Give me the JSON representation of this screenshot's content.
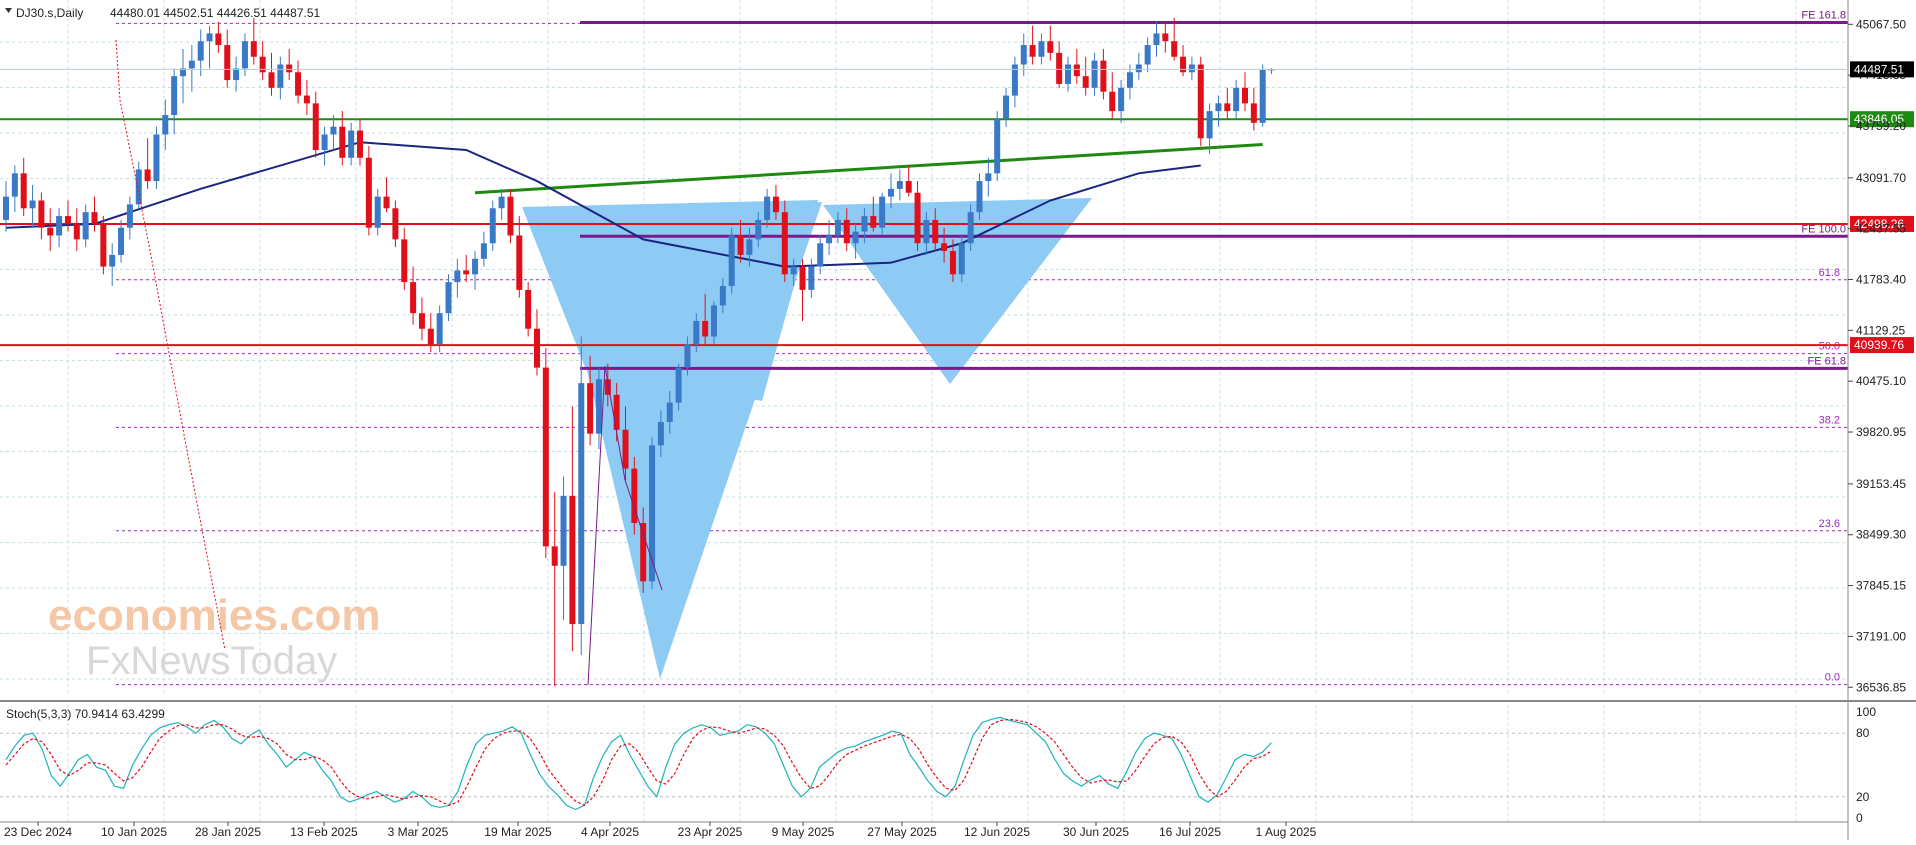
{
  "chart_data": {
    "type": "candlestick",
    "symbol_header": "DJ30.s,Daily",
    "ohlc_header": "44480.01 44502.51 44426.51 44487.51",
    "price_axis_ticks": [
      "45067.50",
      "44413.35",
      "43759.20",
      "43091.70",
      "42437.55",
      "41783.40",
      "41129.25",
      "40475.10",
      "39820.95",
      "39153.45",
      "38499.30",
      "37845.15",
      "37191.00",
      "36536.85"
    ],
    "date_ticks": [
      "23 Dec 2024",
      "10 Jan 2025",
      "28 Jan 2025",
      "13 Feb 2025",
      "3 Mar 2025",
      "19 Mar 2025",
      "4 Apr 2025",
      "23 Apr 2025",
      "9 May 2025",
      "27 May 2025",
      "12 Jun 2025",
      "30 Jun 2025",
      "16 Jul 2025",
      "1 Aug 2025"
    ],
    "ylim": [
      36450,
      45380
    ],
    "candles": [
      [
        42550,
        43050,
        42400,
        42850
      ],
      [
        42850,
        43250,
        42650,
        43150
      ],
      [
        43150,
        43350,
        42600,
        42700
      ],
      [
        42700,
        43000,
        42450,
        42800
      ],
      [
        42800,
        42900,
        42300,
        42450
      ],
      [
        42450,
        42700,
        42150,
        42350
      ],
      [
        42350,
        42700,
        42200,
        42600
      ],
      [
        42600,
        42800,
        42400,
        42500
      ],
      [
        42500,
        42700,
        42150,
        42300
      ],
      [
        42300,
        42750,
        42200,
        42650
      ],
      [
        42650,
        42850,
        42400,
        42500
      ],
      [
        42500,
        42600,
        41850,
        41950
      ],
      [
        41950,
        42250,
        41700,
        42100
      ],
      [
        42100,
        42550,
        42000,
        42450
      ],
      [
        42450,
        42850,
        42300,
        42750
      ],
      [
        42750,
        43300,
        42700,
        43200
      ],
      [
        43200,
        43600,
        42950,
        43050
      ],
      [
        43050,
        43750,
        42950,
        43650
      ],
      [
        43650,
        44100,
        43450,
        43900
      ],
      [
        43900,
        44500,
        43650,
        44400
      ],
      [
        44400,
        44750,
        44050,
        44500
      ],
      [
        44500,
        44800,
        44200,
        44600
      ],
      [
        44600,
        45000,
        44400,
        44850
      ],
      [
        44850,
        45050,
        44500,
        44950
      ],
      [
        44950,
        45100,
        44700,
        44800
      ],
      [
        44800,
        45000,
        44250,
        44350
      ],
      [
        44350,
        44650,
        44200,
        44500
      ],
      [
        44500,
        44950,
        44400,
        44850
      ],
      [
        44850,
        45150,
        44550,
        44650
      ],
      [
        44650,
        44850,
        44350,
        44450
      ],
      [
        44450,
        44700,
        44150,
        44250
      ],
      [
        44250,
        44650,
        44100,
        44550
      ],
      [
        44550,
        44750,
        44350,
        44450
      ],
      [
        44450,
        44600,
        44050,
        44150
      ],
      [
        44150,
        44350,
        43900,
        44050
      ],
      [
        44050,
        44200,
        43350,
        43450
      ],
      [
        43450,
        43750,
        43250,
        43650
      ],
      [
        43650,
        43900,
        43450,
        43750
      ],
      [
        43750,
        43950,
        43250,
        43350
      ],
      [
        43350,
        43800,
        43250,
        43700
      ],
      [
        43700,
        43850,
        43250,
        43350
      ],
      [
        43350,
        43500,
        42350,
        42450
      ],
      [
        42450,
        42950,
        42350,
        42850
      ],
      [
        42850,
        43100,
        42650,
        42700
      ],
      [
        42700,
        42800,
        42200,
        42300
      ],
      [
        42300,
        42450,
        41650,
        41750
      ],
      [
        41750,
        41950,
        41200,
        41350
      ],
      [
        41350,
        41550,
        41000,
        41150
      ],
      [
        41150,
        41350,
        40850,
        40950
      ],
      [
        40950,
        41450,
        40850,
        41350
      ],
      [
        41350,
        41850,
        41250,
        41750
      ],
      [
        41750,
        42050,
        41550,
        41900
      ],
      [
        41900,
        42100,
        41750,
        41850
      ],
      [
        41850,
        42150,
        41650,
        42050
      ],
      [
        42050,
        42400,
        41950,
        42250
      ],
      [
        42250,
        42800,
        42150,
        42700
      ],
      [
        42700,
        42950,
        42550,
        42850
      ],
      [
        42850,
        42950,
        42250,
        42350
      ],
      [
        42350,
        42600,
        41550,
        41650
      ],
      [
        41650,
        41750,
        41050,
        41150
      ],
      [
        41150,
        41400,
        40550,
        40650
      ],
      [
        40650,
        40900,
        38200,
        38350
      ],
      [
        38350,
        39050,
        36550,
        38100
      ],
      [
        38100,
        39250,
        37400,
        39000
      ],
      [
        39000,
        40150,
        37000,
        37350
      ],
      [
        37350,
        41050,
        36950,
        40450
      ],
      [
        40450,
        40800,
        39650,
        39800
      ],
      [
        39800,
        40650,
        39600,
        40500
      ],
      [
        40500,
        40700,
        40150,
        40300
      ],
      [
        40300,
        40450,
        39700,
        39850
      ],
      [
        39850,
        40150,
        39200,
        39350
      ],
      [
        39350,
        39500,
        38500,
        38650
      ],
      [
        38650,
        38850,
        37750,
        37900
      ],
      [
        37900,
        39750,
        37800,
        39650
      ],
      [
        39650,
        40100,
        39500,
        39950
      ],
      [
        39950,
        40350,
        39800,
        40200
      ],
      [
        40200,
        40700,
        40100,
        40650
      ],
      [
        40650,
        41050,
        40550,
        40950
      ],
      [
        40950,
        41350,
        40850,
        41250
      ],
      [
        41250,
        41600,
        40950,
        41050
      ],
      [
        41050,
        41500,
        40950,
        41450
      ],
      [
        41450,
        41800,
        41350,
        41700
      ],
      [
        41700,
        42450,
        41600,
        42350
      ],
      [
        42350,
        42550,
        42000,
        42100
      ],
      [
        42100,
        42450,
        41950,
        42300
      ],
      [
        42300,
        42650,
        42200,
        42550
      ],
      [
        42550,
        42950,
        42450,
        42850
      ],
      [
        42850,
        43000,
        42550,
        42650
      ],
      [
        42650,
        42800,
        41750,
        41850
      ],
      [
        41850,
        42050,
        41700,
        41950
      ],
      [
        41950,
        42050,
        41250,
        41650
      ],
      [
        41650,
        42050,
        41550,
        41950
      ],
      [
        41950,
        42350,
        41850,
        42250
      ],
      [
        42250,
        42550,
        42100,
        42350
      ],
      [
        42350,
        42650,
        42250,
        42550
      ],
      [
        42550,
        42700,
        42150,
        42250
      ],
      [
        42250,
        42500,
        42050,
        42400
      ],
      [
        42400,
        42700,
        42250,
        42600
      ],
      [
        42600,
        42850,
        42400,
        42450
      ],
      [
        42450,
        42900,
        42350,
        42850
      ],
      [
        42850,
        43150,
        42700,
        42950
      ],
      [
        42950,
        43200,
        42800,
        43050
      ],
      [
        43050,
        43250,
        42850,
        42900
      ],
      [
        42900,
        43050,
        42150,
        42250
      ],
      [
        42250,
        42650,
        42100,
        42550
      ],
      [
        42550,
        42700,
        42150,
        42250
      ],
      [
        42250,
        42450,
        42000,
        42150
      ],
      [
        42150,
        42300,
        41750,
        41850
      ],
      [
        41850,
        42350,
        41750,
        42250
      ],
      [
        42250,
        42750,
        42150,
        42650
      ],
      [
        42650,
        43150,
        42550,
        43050
      ],
      [
        43050,
        43350,
        42850,
        43150
      ],
      [
        43150,
        43950,
        43050,
        43850
      ],
      [
        43850,
        44250,
        43750,
        44150
      ],
      [
        44150,
        44650,
        44000,
        44550
      ],
      [
        44550,
        44950,
        44400,
        44800
      ],
      [
        44800,
        45050,
        44550,
        44650
      ],
      [
        44650,
        44950,
        44550,
        44850
      ],
      [
        44850,
        45050,
        44600,
        44700
      ],
      [
        44700,
        44850,
        44250,
        44300
      ],
      [
        44300,
        44650,
        44200,
        44550
      ],
      [
        44550,
        44750,
        44300,
        44400
      ],
      [
        44400,
        44650,
        44150,
        44250
      ],
      [
        44250,
        44700,
        44150,
        44600
      ],
      [
        44600,
        44750,
        44100,
        44200
      ],
      [
        44200,
        44450,
        43850,
        43950
      ],
      [
        43950,
        44350,
        43800,
        44250
      ],
      [
        44250,
        44550,
        44100,
        44450
      ],
      [
        44450,
        44700,
        44350,
        44550
      ],
      [
        44550,
        44900,
        44450,
        44800
      ],
      [
        44800,
        45100,
        44650,
        44950
      ],
      [
        44950,
        45100,
        44700,
        44850
      ],
      [
        44850,
        45150,
        44600,
        44650
      ],
      [
        44650,
        44800,
        44400,
        44450
      ],
      [
        44450,
        44650,
        44350,
        44550
      ],
      [
        44550,
        44650,
        43500,
        43600
      ],
      [
        43600,
        44050,
        43400,
        43950
      ],
      [
        43950,
        44150,
        43750,
        44050
      ],
      [
        44050,
        44250,
        43850,
        43950
      ],
      [
        43950,
        44350,
        43850,
        44250
      ],
      [
        44250,
        44450,
        43950,
        44050
      ],
      [
        44050,
        44250,
        43700,
        43800
      ],
      [
        43800,
        44550,
        43750,
        44480
      ],
      [
        44480,
        44503,
        44427,
        44488
      ]
    ],
    "ma_line": [
      [
        0,
        42450
      ],
      [
        10,
        42500
      ],
      [
        22,
        42950
      ],
      [
        40,
        43550
      ],
      [
        52,
        43450
      ],
      [
        60,
        43050
      ],
      [
        72,
        42300
      ],
      [
        88,
        41950
      ],
      [
        100,
        42000
      ],
      [
        108,
        42250
      ],
      [
        118,
        42800
      ],
      [
        128,
        43150
      ],
      [
        135,
        43250
      ]
    ],
    "horizontal_levels": [
      {
        "price": 45090,
        "label": "FE 161.8",
        "color": "#7b1a8a",
        "style": "solid"
      },
      {
        "price": 43846.05,
        "label": "43846.05",
        "color": "#1e8a12",
        "style": "solid"
      },
      {
        "price": 42498.26,
        "label": "42498.26",
        "color": "#e0101a",
        "style": "solid"
      },
      {
        "price": 42340,
        "label": "FE 100.0",
        "color": "#7b1a8a",
        "style": "solid"
      },
      {
        "price": 40939.76,
        "label": "40939.76",
        "color": "#e0101a",
        "style": "solid"
      },
      {
        "price": 40640,
        "label": "FE 61.8",
        "color": "#7b1a8a",
        "style": "solid"
      }
    ],
    "fibo_levels": [
      {
        "price": 45080,
        "label": ""
      },
      {
        "price": 41780,
        "label": "61.8"
      },
      {
        "price": 40830,
        "label": "50.0"
      },
      {
        "price": 39880,
        "label": "38.2"
      },
      {
        "price": 38550,
        "label": "23.6"
      },
      {
        "price": 36570,
        "label": "0.0"
      }
    ],
    "current_price": "44487.51",
    "trendline": {
      "from": [
        53,
        42900
      ],
      "to": [
        142,
        43520
      ]
    },
    "stochastic": {
      "header": "Stoch(5,3,3) 70.9414 63.4299",
      "levels": [
        "100",
        "80",
        "20",
        "0"
      ],
      "k": [
        55,
        68,
        78,
        80,
        65,
        40,
        30,
        42,
        55,
        60,
        48,
        45,
        30,
        28,
        50,
        65,
        78,
        85,
        88,
        90,
        86,
        80,
        88,
        92,
        86,
        75,
        70,
        78,
        83,
        70,
        60,
        48,
        55,
        62,
        58,
        45,
        35,
        20,
        15,
        18,
        22,
        25,
        20,
        15,
        18,
        25,
        20,
        12,
        10,
        12,
        25,
        50,
        70,
        78,
        80,
        82,
        86,
        80,
        60,
        42,
        30,
        22,
        12,
        8,
        12,
        38,
        58,
        72,
        78,
        60,
        45,
        30,
        20,
        48,
        70,
        80,
        85,
        88,
        85,
        78,
        80,
        82,
        88,
        86,
        80,
        70,
        50,
        30,
        20,
        28,
        48,
        55,
        62,
        66,
        68,
        72,
        75,
        78,
        82,
        80,
        60,
        48,
        35,
        25,
        20,
        30,
        55,
        78,
        90,
        93,
        95,
        92,
        90,
        88,
        80,
        72,
        56,
        42,
        35,
        30,
        36,
        40,
        32,
        28,
        44,
        62,
        75,
        80,
        78,
        75,
        60,
        40,
        20,
        15,
        22,
        38,
        55,
        60,
        58,
        62,
        71
      ],
      "d": [
        50,
        60,
        70,
        75,
        72,
        60,
        45,
        40,
        45,
        52,
        52,
        50,
        42,
        35,
        38,
        48,
        62,
        75,
        82,
        87,
        88,
        85,
        85,
        88,
        88,
        84,
        78,
        76,
        77,
        75,
        70,
        60,
        55,
        55,
        58,
        55,
        48,
        35,
        25,
        20,
        18,
        20,
        22,
        20,
        18,
        20,
        21,
        20,
        16,
        12,
        15,
        30,
        48,
        65,
        75,
        80,
        82,
        82,
        75,
        62,
        46,
        35,
        24,
        16,
        12,
        20,
        35,
        55,
        68,
        70,
        62,
        48,
        35,
        32,
        42,
        60,
        75,
        83,
        86,
        85,
        82,
        80,
        82,
        85,
        84,
        78,
        68,
        52,
        38,
        28,
        30,
        40,
        52,
        60,
        64,
        68,
        71,
        74,
        77,
        79,
        75,
        65,
        50,
        38,
        28,
        26,
        36,
        55,
        75,
        88,
        92,
        93,
        92,
        90,
        86,
        80,
        72,
        60,
        48,
        38,
        33,
        35,
        36,
        34,
        35,
        45,
        58,
        70,
        76,
        77,
        72,
        60,
        42,
        28,
        20,
        25,
        36,
        48,
        56,
        58,
        63
      ]
    },
    "watermark": {
      "line1": "economies.com",
      "line2": "FxNewsToday"
    }
  },
  "colors": {
    "bull": "#3a79c6",
    "bear": "#e0101a",
    "ma": "#1b2580",
    "trend": "#1e8a12",
    "triangle": "#8dcbf5",
    "fibo": "#a12ac1",
    "stoch_k": "#1fb3b9",
    "stoch_d": "#e0101a",
    "grid": "#c6dde6"
  }
}
